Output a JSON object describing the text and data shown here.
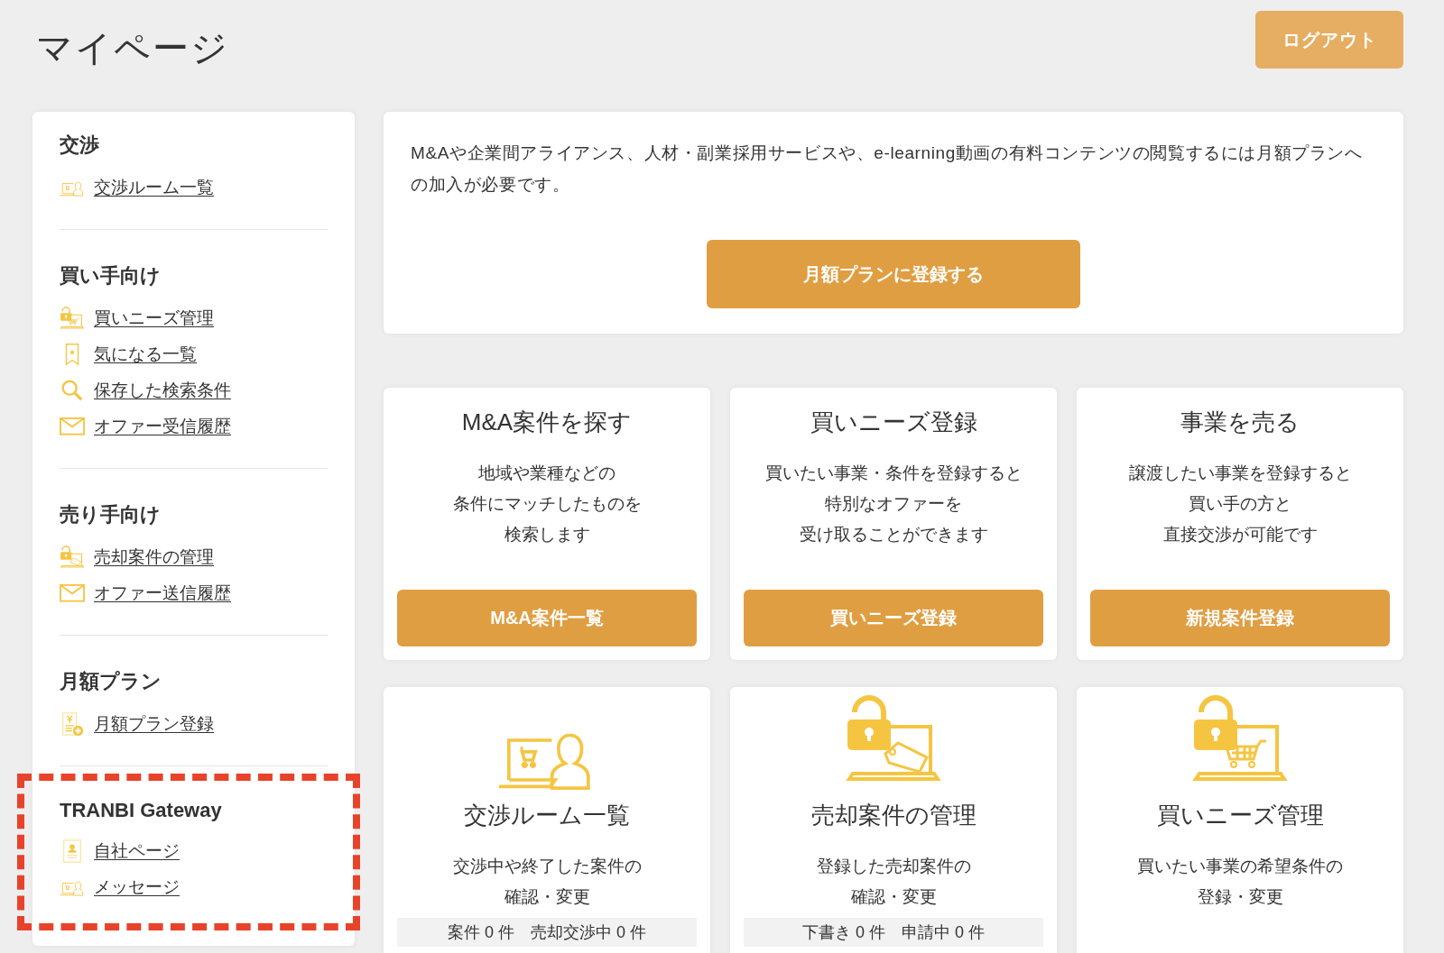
{
  "page": {
    "title": "マイページ",
    "logout_button": "ログアウト"
  },
  "sidebar": {
    "sections": [
      {
        "heading": "交渉",
        "highlighted": false,
        "links": [
          "交渉ルーム一覧"
        ]
      },
      {
        "heading": "買い手向け",
        "highlighted": false,
        "links": [
          "買いニーズ管理",
          "気になる一覧",
          "保存した検索条件",
          "オファー受信履歴"
        ]
      },
      {
        "heading": "売り手向け",
        "highlighted": false,
        "links": [
          "売却案件の管理",
          "オファー送信履歴"
        ]
      },
      {
        "heading": "月額プラン",
        "highlighted": false,
        "links": [
          "月額プラン登録"
        ]
      },
      {
        "heading": "TRANBI Gateway",
        "highlighted": true,
        "links": [
          "自社ページ",
          "メッセージ"
        ]
      }
    ]
  },
  "notice": {
    "text": "M&Aや企業間アライアンス、人材・副業採用サービスや、e-learning動画の有料コンテンツの閲覧するには月額プランへの加入が必要です。",
    "button": "月額プランに登録する"
  },
  "feature_cards": [
    {
      "title": "M&A案件を探す",
      "description": [
        "地域や業種などの",
        "条件にマッチしたものを",
        "検索します"
      ],
      "button": "M&A案件一覧"
    },
    {
      "title": "買いニーズ登録",
      "description": [
        "買いたい事業・条件を登録すると",
        "特別なオファーを",
        "受け取ることができます"
      ],
      "button": "買いニーズ登録"
    },
    {
      "title": "事業を売る",
      "description": [
        "譲渡したい事業を登録すると",
        "買い手の方と",
        "直接交渉が可能です"
      ],
      "button": "新規案件登録"
    }
  ],
  "management_cards": [
    {
      "title": "交渉ルーム一覧",
      "description": [
        "交渉中や終了した案件の",
        "確認・変更"
      ],
      "stats": "案件 0 件　売却交渉中 0 件"
    },
    {
      "title": "売却案件の管理",
      "description": [
        "登録した売却案件の",
        "確認・変更"
      ],
      "stats": "下書き 0 件　申請中 0 件"
    },
    {
      "title": "買いニーズ管理",
      "description": [
        "買いたい事業の希望条件の",
        "登録・変更"
      ]
    }
  ]
}
